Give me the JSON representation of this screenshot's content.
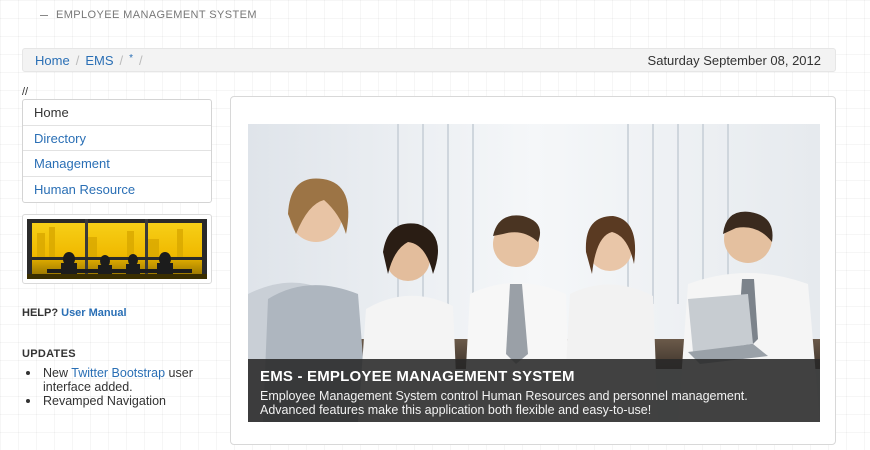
{
  "header": {
    "brand": "EMPLOYEE MANAGEMENT SYSTEM"
  },
  "breadcrumb": {
    "items": [
      "Home",
      "EMS"
    ],
    "current": "*",
    "separator": "/",
    "date": "Saturday September 08, 2012"
  },
  "comment": "//",
  "sidebar": {
    "nav": [
      {
        "label": "Home"
      },
      {
        "label": "Directory"
      },
      {
        "label": "Management"
      },
      {
        "label": "Human Resource"
      }
    ],
    "help_label": "HELP?",
    "help_link": "User Manual",
    "updates_title": "UPDATES",
    "updates": {
      "item1_prefix": "New ",
      "item1_link": "Twitter Bootstrap",
      "item1_suffix": " user interface added.",
      "item2": "Revamped Navigation"
    }
  },
  "hero": {
    "title": "EMS - EMPLOYEE MANAGEMENT SYSTEM",
    "line1": "Employee Management System control Human Resources and personnel management.",
    "line2": "Advanced features make this application both flexible and easy-to-use!"
  },
  "colors": {
    "link": "#2a6fb5",
    "caption_bg": "#282828",
    "thumb_accent": "#f3c90b"
  }
}
